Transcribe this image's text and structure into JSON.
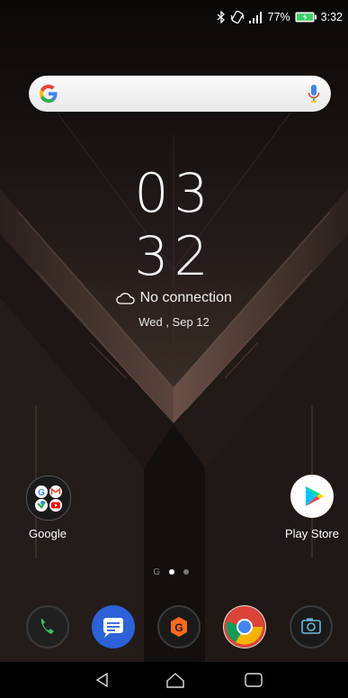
{
  "status_bar": {
    "battery_percent": "77%",
    "time": "3:32",
    "icons": [
      "bluetooth-icon",
      "vibrate-icon",
      "signal-icon",
      "battery-icon"
    ]
  },
  "search": {
    "logo": "G",
    "icons": [
      "google-logo-icon",
      "mic-icon"
    ]
  },
  "clock": {
    "hour": "03",
    "minute": "32",
    "weather": "No connection",
    "date": "Wed , Sep 12"
  },
  "apps": {
    "google_folder_label": "Google",
    "play_store_label": "Play Store"
  },
  "page_indicator": {
    "g_label": "G",
    "pages": 2,
    "active": 0
  },
  "dock": [
    "Phone",
    "Messages",
    "Game Genie",
    "Chrome",
    "Camera"
  ],
  "nav": [
    "back",
    "home",
    "recents"
  ]
}
